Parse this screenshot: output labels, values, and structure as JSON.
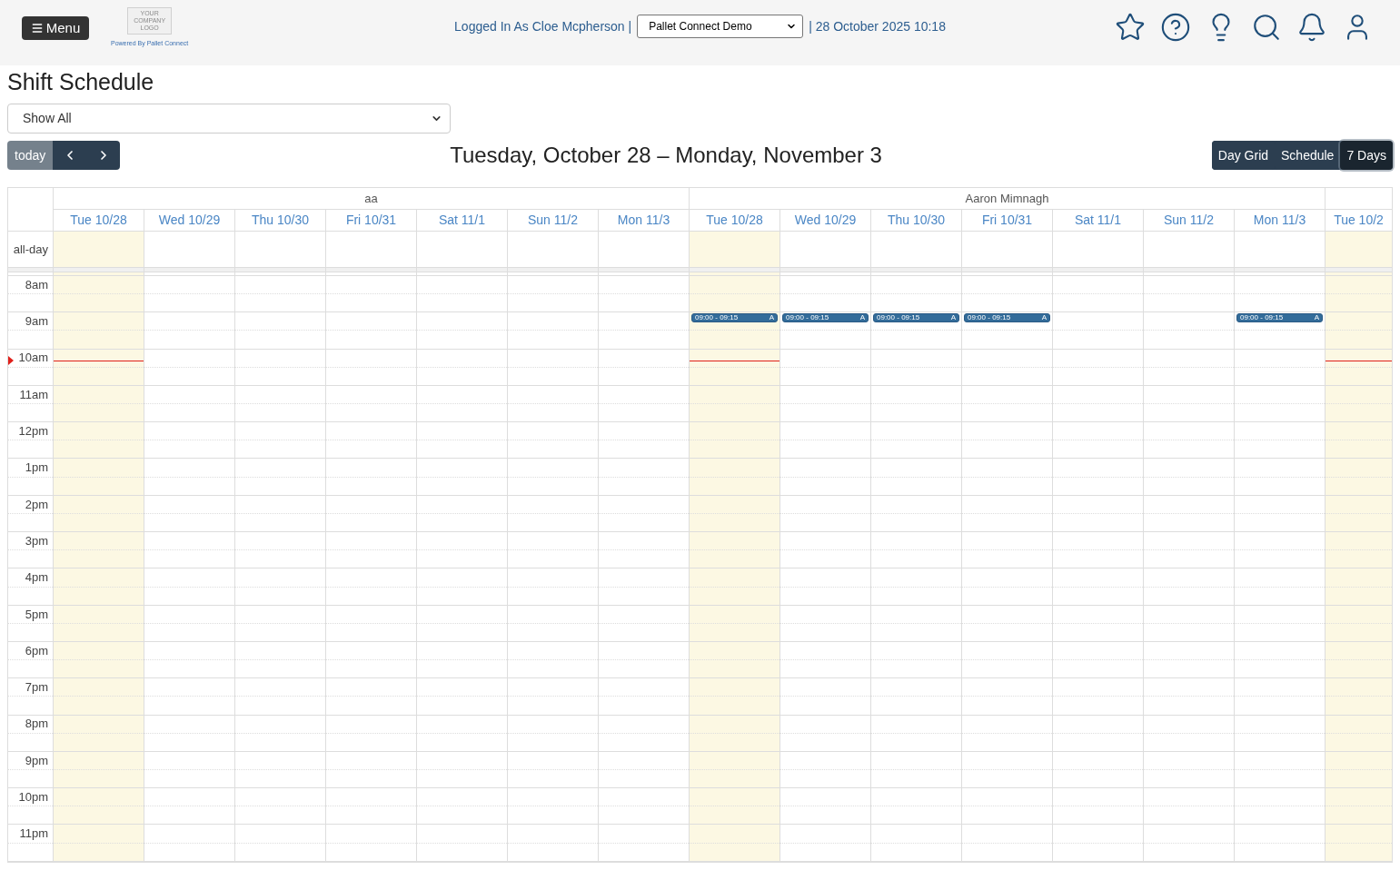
{
  "header": {
    "menu_button": "Menu",
    "logo": {
      "lines": [
        "YOUR",
        "COMPANY",
        "LOGO"
      ]
    },
    "powered_by": "Powered By Pallet Connect",
    "logged_in": "Logged In As Cloe Mcpherson |",
    "company_select": {
      "value": "Pallet Connect Demo"
    },
    "datetime": "| 28 October 2025 10:18"
  },
  "page": {
    "title": "Shift Schedule",
    "filter_select": {
      "value": "Show All"
    }
  },
  "toolbar": {
    "today_button": {
      "label": "today",
      "disabled": true
    },
    "title": "Tuesday, October 28 – Monday, November 3",
    "views": [
      {
        "label": "Day Grid",
        "selected": false
      },
      {
        "label": "Schedule",
        "selected": false
      },
      {
        "label": "7 Days",
        "selected": true
      }
    ]
  },
  "calendar": {
    "all_day_label": "all-day",
    "now_indicator": true,
    "time_labels": [
      "8am",
      "9am",
      "10am",
      "11am",
      "12pm",
      "1pm",
      "2pm",
      "3pm",
      "4pm",
      "5pm",
      "6pm",
      "7pm",
      "8pm",
      "9pm",
      "10pm",
      "11pm"
    ],
    "resources": [
      {
        "name": "aa",
        "days": [
          {
            "label": "Tue 10/28",
            "today": true
          },
          {
            "label": "Wed 10/29",
            "today": false
          },
          {
            "label": "Thu 10/30",
            "today": false
          },
          {
            "label": "Fri 10/31",
            "today": false
          },
          {
            "label": "Sat 11/1",
            "today": false
          },
          {
            "label": "Sun 11/2",
            "today": false
          },
          {
            "label": "Mon 11/3",
            "today": false
          }
        ]
      },
      {
        "name": "Aaron Mimnagh",
        "days": [
          {
            "label": "Tue 10/28",
            "today": true,
            "events": [
              {
                "time": "09:00 - 09:15",
                "title": "A"
              }
            ]
          },
          {
            "label": "Wed 10/29",
            "today": false,
            "events": [
              {
                "time": "09:00 - 09:15",
                "title": "A"
              }
            ]
          },
          {
            "label": "Thu 10/30",
            "today": false,
            "events": [
              {
                "time": "09:00 - 09:15",
                "title": "A"
              }
            ]
          },
          {
            "label": "Fri 10/31",
            "today": false,
            "events": [
              {
                "time": "09:00 - 09:15",
                "title": "A"
              }
            ]
          },
          {
            "label": "Sat 11/1",
            "today": false
          },
          {
            "label": "Sun 11/2",
            "today": false
          },
          {
            "label": "Mon 11/3",
            "today": false,
            "events": [
              {
                "time": "09:00 - 09:15",
                "title": "A"
              }
            ]
          }
        ]
      },
      {
        "days": [
          {
            "label": "Tue 10/2",
            "today": true
          }
        ]
      }
    ]
  }
}
